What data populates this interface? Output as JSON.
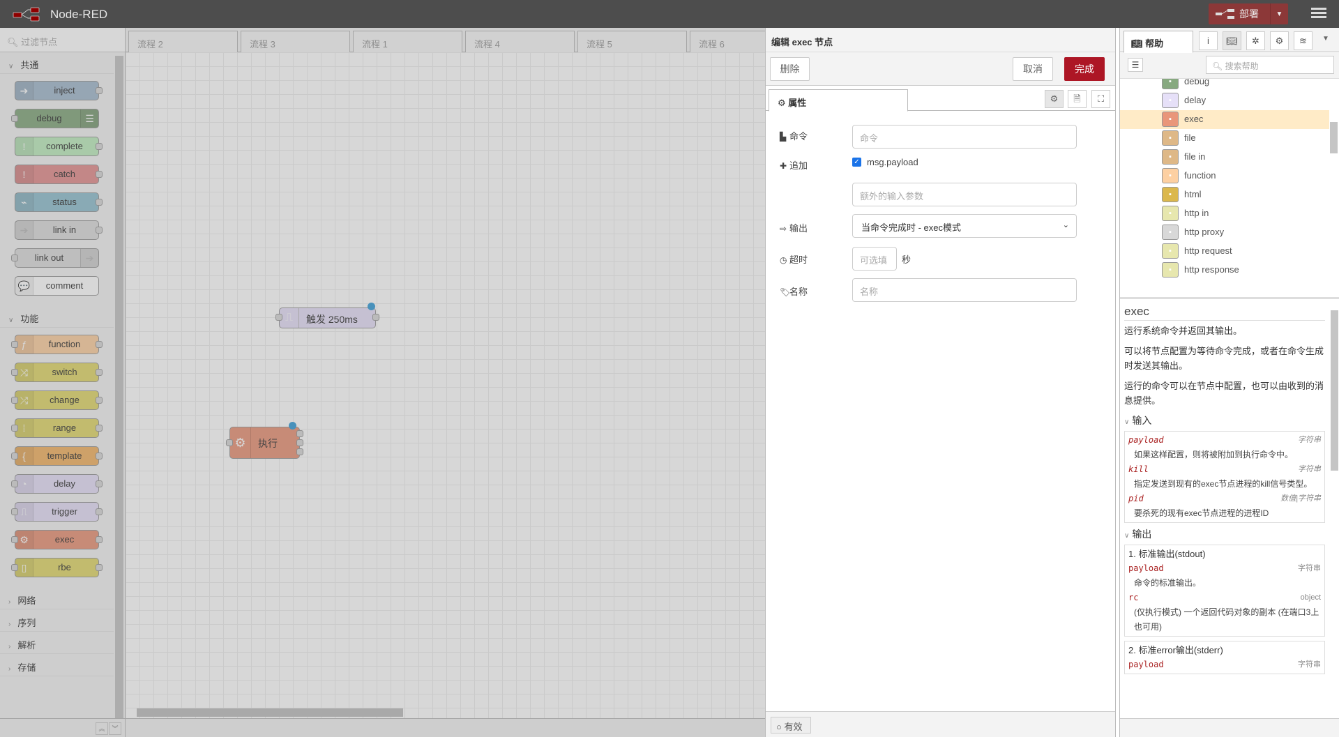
{
  "header": {
    "title": "Node-RED",
    "deploy_label": "部署"
  },
  "palette": {
    "filter_placeholder": "过滤节点",
    "categories": [
      {
        "label": "共通",
        "expanded": true,
        "nodes": [
          {
            "label": "inject",
            "color": "#a6bbcf",
            "icon": "arrow-right-icon",
            "glyph": "➔",
            "in": false,
            "out": true,
            "iconSide": "l"
          },
          {
            "label": "debug",
            "color": "#87a980",
            "icon": "list-icon",
            "glyph": "☰",
            "in": true,
            "out": false,
            "iconSide": "r"
          },
          {
            "label": "complete",
            "color": "#c0edc0",
            "icon": "alert-icon",
            "glyph": "!",
            "in": false,
            "out": true,
            "iconSide": "l"
          },
          {
            "label": "catch",
            "color": "#e49191",
            "icon": "alert-icon",
            "glyph": "!",
            "in": false,
            "out": true,
            "iconSide": "l"
          },
          {
            "label": "status",
            "color": "#94c1d0",
            "icon": "pulse-icon",
            "glyph": "⌁",
            "in": false,
            "out": true,
            "iconSide": "l"
          },
          {
            "label": "link in",
            "color": "#dddddd",
            "icon": "link-icon",
            "glyph": "➔",
            "in": false,
            "out": true,
            "iconSide": "l"
          },
          {
            "label": "link out",
            "color": "#dddddd",
            "icon": "link-icon",
            "glyph": "➔",
            "in": true,
            "out": false,
            "iconSide": "r"
          },
          {
            "label": "comment",
            "color": "#ffffff",
            "icon": "comment-icon",
            "glyph": "💬",
            "in": false,
            "out": false,
            "iconSide": "l"
          }
        ]
      },
      {
        "label": "功能",
        "expanded": true,
        "nodes": [
          {
            "label": "function",
            "color": "#fdd0a2",
            "icon": "function-icon",
            "glyph": "ƒ",
            "in": true,
            "out": true,
            "iconSide": "l"
          },
          {
            "label": "switch",
            "color": "#e2d96e",
            "icon": "switch-icon",
            "glyph": "⤨",
            "in": true,
            "out": true,
            "iconSide": "l"
          },
          {
            "label": "change",
            "color": "#e2d96e",
            "icon": "shuffle-icon",
            "glyph": "⤮",
            "in": true,
            "out": true,
            "iconSide": "l"
          },
          {
            "label": "range",
            "color": "#e2d96e",
            "icon": "range-icon",
            "glyph": "⁞",
            "in": true,
            "out": true,
            "iconSide": "l"
          },
          {
            "label": "template",
            "color": "#f3b567",
            "icon": "template-icon",
            "glyph": "{",
            "in": true,
            "out": true,
            "iconSide": "l"
          },
          {
            "label": "delay",
            "color": "#e6e0f8",
            "icon": "timer-icon",
            "glyph": "◔",
            "in": true,
            "out": true,
            "iconSide": "l"
          },
          {
            "label": "trigger",
            "color": "#e6e0f8",
            "icon": "trigger-icon",
            "glyph": "⎍",
            "in": true,
            "out": true,
            "iconSide": "l"
          },
          {
            "label": "exec",
            "color": "#e9967a",
            "icon": "cog-icon",
            "glyph": "⚙",
            "in": true,
            "out": true,
            "iconSide": "l"
          },
          {
            "label": "rbe",
            "color": "#e2d96e",
            "icon": "rbe-icon",
            "glyph": "▯",
            "in": true,
            "out": true,
            "iconSide": "l"
          }
        ]
      },
      {
        "label": "网络",
        "expanded": false
      },
      {
        "label": "序列",
        "expanded": false
      },
      {
        "label": "解析",
        "expanded": false
      },
      {
        "label": "存储",
        "expanded": false
      }
    ]
  },
  "workspace": {
    "tabs": [
      "流程 2",
      "流程 3",
      "流程 1",
      "流程 4",
      "流程 5",
      "流程 6"
    ],
    "nodes": [
      {
        "label": "触发 250ms",
        "color": "#e6e0f8",
        "icon": "trigger-icon"
      },
      {
        "label": "执行",
        "color": "#e9967a",
        "icon": "cog-icon"
      }
    ]
  },
  "editor": {
    "title": "编辑 exec 节点",
    "delete_label": "删除",
    "cancel_label": "取消",
    "done_label": "完成",
    "tab_properties": "属性",
    "fields": {
      "command": {
        "label": "命令",
        "placeholder": "命令"
      },
      "append": {
        "label": "追加",
        "checkbox_label": "msg.payload",
        "checked": true,
        "extra_placeholder": "额外的输入参数"
      },
      "output": {
        "label": "输出",
        "value": "当命令完成时 - exec模式"
      },
      "timeout": {
        "label": "超时",
        "placeholder": "可选填",
        "unit": "秒"
      },
      "name": {
        "label": "名称",
        "placeholder": "名称"
      }
    },
    "enabled_label": "有效"
  },
  "sidebar": {
    "tab_help": "帮助",
    "search_placeholder": "搜索帮助",
    "node_list": [
      {
        "label": "debug",
        "color": "#87a980"
      },
      {
        "label": "delay",
        "color": "#e6e0f8"
      },
      {
        "label": "exec",
        "color": "#e9967a",
        "selected": true
      },
      {
        "label": "file",
        "color": "#deb887"
      },
      {
        "label": "file in",
        "color": "#deb887"
      },
      {
        "label": "function",
        "color": "#fdd0a2"
      },
      {
        "label": "html",
        "color": "#dbb84d"
      },
      {
        "label": "http in",
        "color": "#e7e7ae"
      },
      {
        "label": "http proxy",
        "color": "#d8d8d8"
      },
      {
        "label": "http request",
        "color": "#e7e7ae"
      },
      {
        "label": "http response",
        "color": "#e7e7ae"
      }
    ],
    "help": {
      "title": "exec",
      "p1": "运行系统命令并返回其输出。",
      "p2": "可以将节点配置为等待命令完成，或者在命令生成时发送其输出。",
      "p3": "运行的命令可以在节点中配置，也可以由收到的消息提供。",
      "inputs_title": "输入",
      "inputs": [
        {
          "name": "payload",
          "type": "字符串",
          "desc": "如果这样配置，则将被附加到执行命令中。"
        },
        {
          "name": "kill",
          "type": "字符串",
          "desc": "指定发送到现有的exec节点进程的kill信号类型。"
        },
        {
          "name": "pid",
          "type": "数值|字符串",
          "desc": "要杀死的现有exec节点进程的进程ID"
        }
      ],
      "outputs_title": "输出",
      "output1_title": "1. 标准输出(stdout)",
      "output1": [
        {
          "name": "payload",
          "type": "字符串",
          "desc": "命令的标准输出。"
        },
        {
          "name": "rc",
          "type": "object",
          "desc": "(仅执行模式) 一个返回代码对象的副本 (在端口3上也可用)"
        }
      ],
      "output2_title": "2. 标准error输出(stderr)",
      "output2": [
        {
          "name": "payload",
          "type": "字符串"
        }
      ]
    }
  }
}
